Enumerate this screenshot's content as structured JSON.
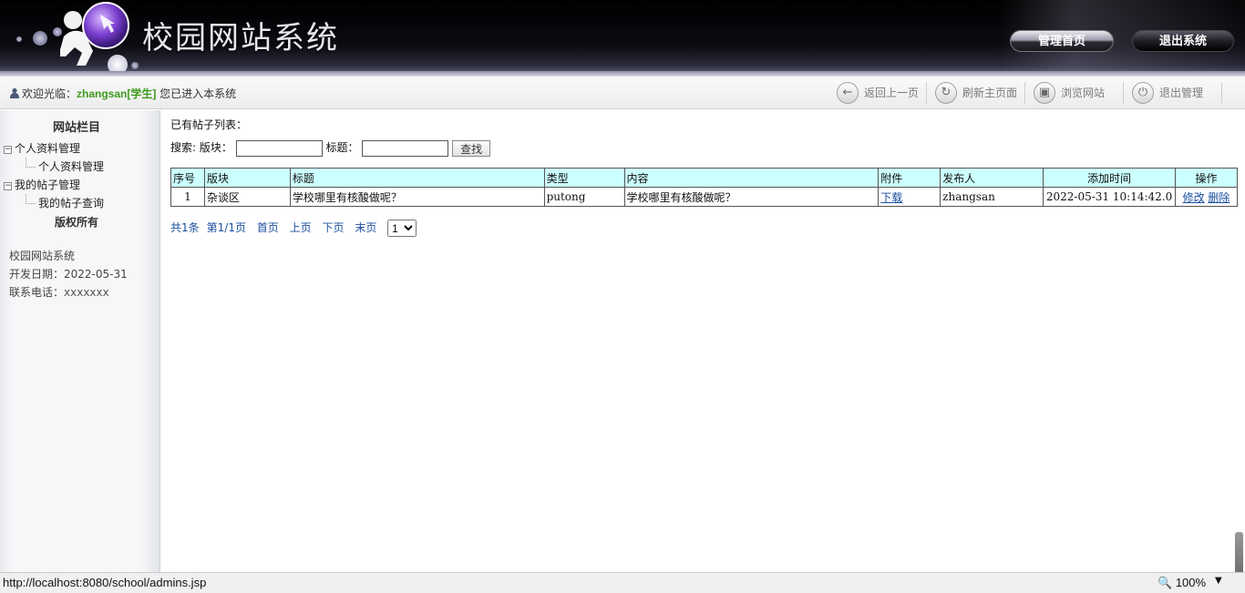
{
  "header": {
    "site_title": "校园网站系统",
    "home_button": "管理首页",
    "logout_button": "退出系统"
  },
  "toolbar": {
    "welcome_prefix": "欢迎光临：",
    "user": "zhangsan[学生]",
    "welcome_suffix": " 您已进入本系统",
    "back_label": "返回上一页",
    "refresh_label": "刷新主页面",
    "browse_label": "浏览网站",
    "exit_label": "退出管理"
  },
  "sidebar": {
    "title": "网站栏目",
    "groups": [
      {
        "label": "个人资料管理",
        "children": [
          "个人资料管理"
        ]
      },
      {
        "label": "我的帖子管理",
        "children": [
          "我的帖子查询"
        ]
      }
    ],
    "footer_title": "版权所有",
    "info": {
      "system_name": "校园网站系统",
      "dev_date_label": "开发日期：",
      "dev_date": "2022-05-31",
      "phone_label": "联系电话：",
      "phone": "xxxxxxx"
    }
  },
  "main": {
    "list_title": "已有帖子列表：",
    "search": {
      "prefix": "搜索: 版块：",
      "title_label": "标题：",
      "button": "查找",
      "section_value": "",
      "title_value": ""
    },
    "table": {
      "headers": [
        "序号",
        "版块",
        "标题",
        "类型",
        "内容",
        "附件",
        "发布人",
        "添加时间",
        "操作"
      ],
      "rows": [
        {
          "index": "1",
          "section": "杂谈区",
          "title": "学校哪里有核酸做呢？",
          "type": "putong",
          "content": "学校哪里有核酸做呢？",
          "attachment": "下载",
          "author": "zhangsan",
          "time": "2022-05-31 10:14:42.0",
          "edit": "修改",
          "delete": "删除"
        }
      ]
    },
    "pager": {
      "total": "共1条",
      "page_info": "第1/1页",
      "first": "首页",
      "prev": "上页",
      "next": "下页",
      "last": "末页",
      "selected_page": "1"
    }
  },
  "statusbar": {
    "url": "http://localhost:8080/school/admins.jsp",
    "zoom": "100%"
  },
  "colors": {
    "table_header_bg": "#ccffff",
    "user_green": "#3d9a1f",
    "link_blue": "#1a4fa0"
  }
}
